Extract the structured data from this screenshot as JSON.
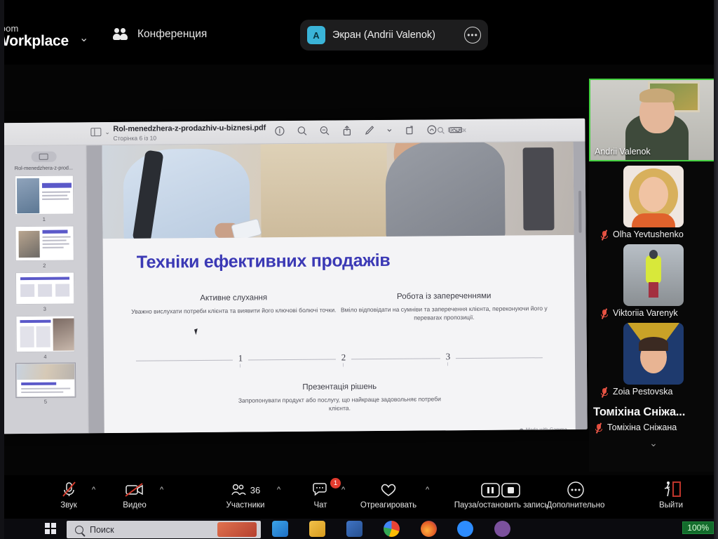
{
  "app": {
    "brand_line1": "zoom",
    "brand_line2": "Workplace",
    "conference_label": "Конференция",
    "chevron": "⌄"
  },
  "share_pill": {
    "avatar_letter": "A",
    "text": "Экран (Andrii Valenok)",
    "more": "•••"
  },
  "pdf": {
    "file_name": "Rol-menedzhera-z-prodazhiv-u-biznesi.pdf",
    "page_label": "Сторінка 6 із 10",
    "sidebar_title": "Rol-menedzhera-z-prod...",
    "search_placeholder": "Поиск",
    "thumbnails": [
      {
        "number": "1"
      },
      {
        "number": "2"
      },
      {
        "number": "3"
      },
      {
        "number": "4"
      },
      {
        "number": "5"
      }
    ],
    "toolbar_icons": [
      "info-icon",
      "zoom-out-icon",
      "zoom-in-icon",
      "share-icon",
      "markup-icon",
      "markup-chevron-icon",
      "rotate-icon",
      "highlight-icon",
      "signature-icon",
      "search-icon"
    ]
  },
  "slide": {
    "title": "Техніки ефективних продажів",
    "columns": [
      {
        "heading": "Активне слухання",
        "body": "Уважно вислухати потреби клієнта та виявити його ключові болючі точки."
      },
      {
        "heading": "Робота із запереченнями",
        "body": "Вміло відповідати на сумніви та заперечення клієнта, переконуючи його у перевагах пропозиції."
      },
      {
        "heading": "Презентація рішень",
        "body": "Запропонувати продукт або послугу, що найкраще задовольняє потреби клієнта."
      }
    ],
    "timeline_marks": [
      "1",
      "2",
      "3"
    ],
    "watermark": "Made with Gamma"
  },
  "participants": {
    "active_speaker": {
      "name": "Andrii Valenok",
      "muted": false
    },
    "list": [
      {
        "name": "Olha Yevtushenko",
        "muted": true
      },
      {
        "name": "Viktoriia Varenyk",
        "muted": true
      },
      {
        "name": "Zoia Pestovska",
        "muted": true
      }
    ],
    "pinned_name": "Томіхіна Сніжа...",
    "pinned_row_name": "Томіхіна Сніжана",
    "collapse_chevron": "⌄"
  },
  "toolbar": {
    "audio_label": "Звук",
    "video_label": "Видео",
    "participants_label": "Участники",
    "participants_count": "36",
    "chat_label": "Чат",
    "chat_badge": "1",
    "react_label": "Отреагировать",
    "record_label": "Пауза/остановить запись",
    "more_label": "Дополнительно",
    "leave_label": "Выйти",
    "chevron": "^"
  },
  "taskbar": {
    "search_placeholder": "Поиск",
    "battery": "100%",
    "apps": [
      "photos-icon",
      "mail-icon",
      "explorer-icon",
      "store-icon",
      "chrome-icon",
      "firefox-icon",
      "zoom-icon",
      "viber-icon"
    ]
  },
  "colors": {
    "accent_green": "#43d13f",
    "slide_title": "#3b39b5",
    "badge_red": "#e23b2e",
    "battery_green": "#136b2c",
    "share_avatar": "#3ab4d8"
  }
}
